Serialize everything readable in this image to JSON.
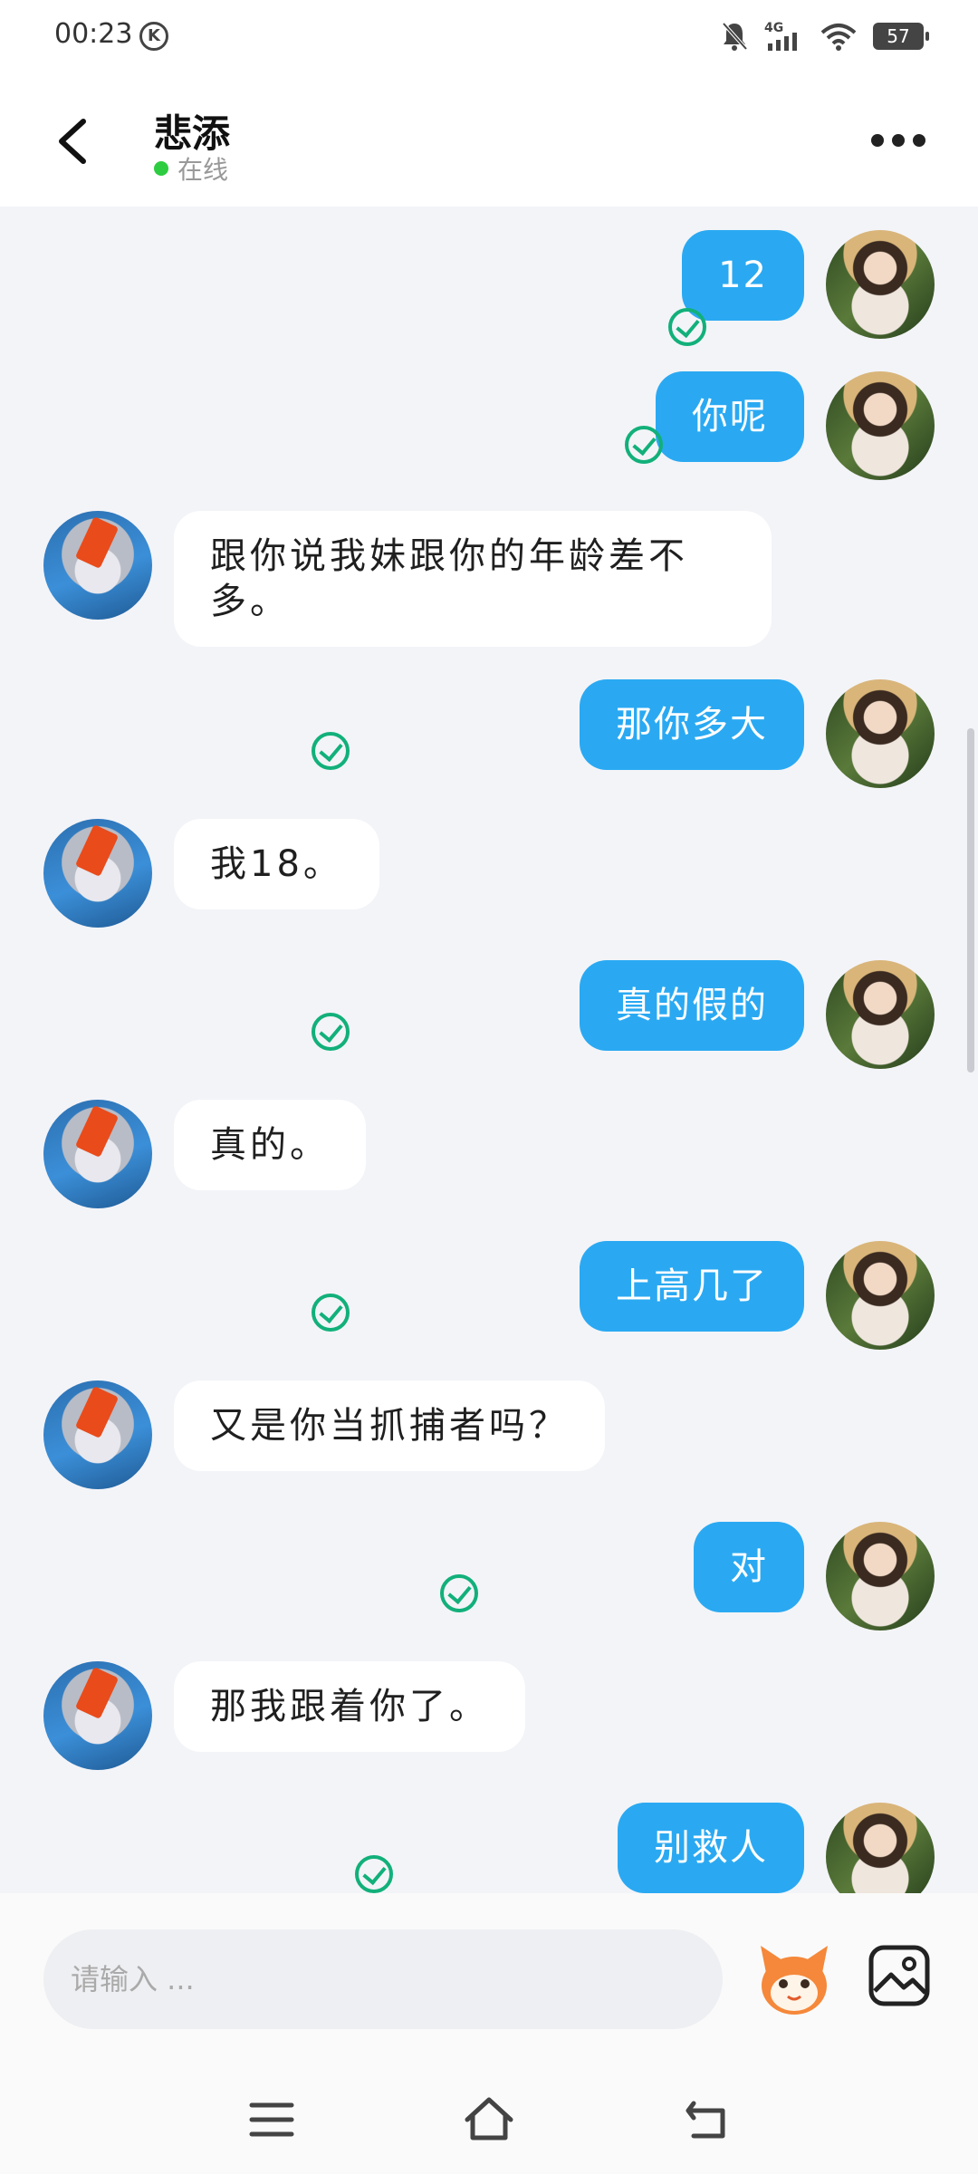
{
  "status_bar": {
    "time": "00:23",
    "k_badge": "K",
    "network": "4G",
    "battery": "57"
  },
  "header": {
    "contact_name": "悲添",
    "presence": "在线"
  },
  "messages": [
    {
      "side": "me",
      "text": "12"
    },
    {
      "side": "me",
      "text": "你呢"
    },
    {
      "side": "other",
      "text": "跟你说我妹跟你的年龄差不多。"
    },
    {
      "side": "me",
      "text": "那你多大"
    },
    {
      "side": "other",
      "text": "我18。"
    },
    {
      "side": "me",
      "text": "真的假的"
    },
    {
      "side": "other",
      "text": "真的。"
    },
    {
      "side": "me",
      "text": "上高几了"
    },
    {
      "side": "other",
      "text": "又是你当抓捕者吗？"
    },
    {
      "side": "me",
      "text": "对"
    },
    {
      "side": "other",
      "text": "那我跟着你了。"
    },
    {
      "side": "me",
      "text": "别救人"
    }
  ],
  "composer": {
    "placeholder": "请输入 ..."
  },
  "icons": {
    "back": "chevron-left-icon",
    "more": "more-horizontal-icon",
    "sent": "check-circle-icon",
    "emoji": "emoji-mascot-icon",
    "image": "image-icon",
    "nav_menu": "menu-icon",
    "nav_home": "home-icon",
    "nav_back": "return-icon"
  },
  "colors": {
    "bubble_me": "#2aa9f2",
    "bubble_other": "#ffffff",
    "sent_check": "#12b07a",
    "online_dot": "#2ecc40"
  }
}
